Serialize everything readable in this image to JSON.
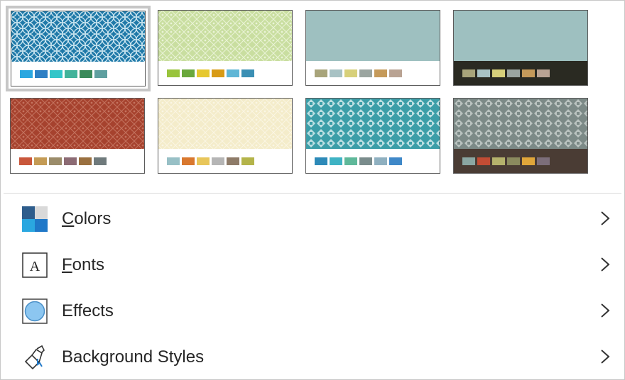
{
  "variants": [
    {
      "pattern": "circles",
      "bg": "#1f79a8",
      "fg": "#cfe8f2",
      "band": "#ffffff",
      "swatches": [
        "#2aa7e0",
        "#2d7fc4",
        "#33c6c9",
        "#42b39a",
        "#3a8a5a",
        "#5f9f9f"
      ],
      "selected": true
    },
    {
      "pattern": "diamond",
      "bg": "#c9dea0",
      "fg": "#eaf3d7",
      "band": "#ffffff",
      "swatches": [
        "#99c43c",
        "#6aa83c",
        "#e6c82f",
        "#d89b16",
        "#5fb6d6",
        "#3b8fb4"
      ],
      "selected": false
    },
    {
      "pattern": "solid",
      "bg": "#9ec0c0",
      "fg": "#9ec0c0",
      "band": "#ffffff",
      "swatches": [
        "#a8a47a",
        "#a8c2c4",
        "#d7d07a",
        "#9ba5a0",
        "#c59a5a",
        "#b9a393"
      ],
      "selected": false
    },
    {
      "pattern": "solid",
      "bg": "#9ec0c0",
      "fg": "#9ec0c0",
      "band": "#2a2a22",
      "swatches": [
        "#a8a47a",
        "#a8c2c4",
        "#d7d07a",
        "#9ba5a0",
        "#c59a5a",
        "#b9a393"
      ],
      "selected": false
    },
    {
      "pattern": "diamond",
      "bg": "#a6422e",
      "fg": "#c4735f",
      "band": "#ffffff",
      "swatches": [
        "#c9573b",
        "#c49b55",
        "#9b8c6a",
        "#8c6b74",
        "#9a7040",
        "#6f7a7c"
      ],
      "selected": false
    },
    {
      "pattern": "diamond",
      "bg": "#f4ecca",
      "fg": "#faf6e4",
      "band": "#ffffff",
      "swatches": [
        "#98c0c6",
        "#d9782e",
        "#e8c65a",
        "#b5b5b5",
        "#8e7b68",
        "#b4b44a"
      ],
      "selected": false
    },
    {
      "pattern": "lattice",
      "bg": "#3c9ea8",
      "fg": "#e7f4f5",
      "band": "#ffffff",
      "swatches": [
        "#2d8ab8",
        "#3fb3c4",
        "#5fb89a",
        "#7a8c8c",
        "#8fb0c0",
        "#3f88c8"
      ],
      "selected": false
    },
    {
      "pattern": "lattice",
      "bg": "#7c8a87",
      "fg": "#cfd5d3",
      "band": "#4a3c34",
      "swatches": [
        "#8aa6a2",
        "#c24c34",
        "#b5b26c",
        "#8a8a5e",
        "#e0a63a",
        "#7c6e7a"
      ],
      "selected": false
    }
  ],
  "menu": {
    "items": [
      {
        "label": "Colors",
        "mnemonic": "C",
        "rest": "olors",
        "icon": "colors-icon"
      },
      {
        "label": "Fonts",
        "mnemonic": "F",
        "rest": "onts",
        "icon": "fonts-icon"
      },
      {
        "label": "Effects",
        "mnemonic": "",
        "rest": "Effects",
        "icon": "effects-icon"
      },
      {
        "label": "Background Styles",
        "mnemonic": "",
        "rest": "Background Styles",
        "icon": "background-styles-icon"
      }
    ],
    "font_icon_letter": "A"
  }
}
